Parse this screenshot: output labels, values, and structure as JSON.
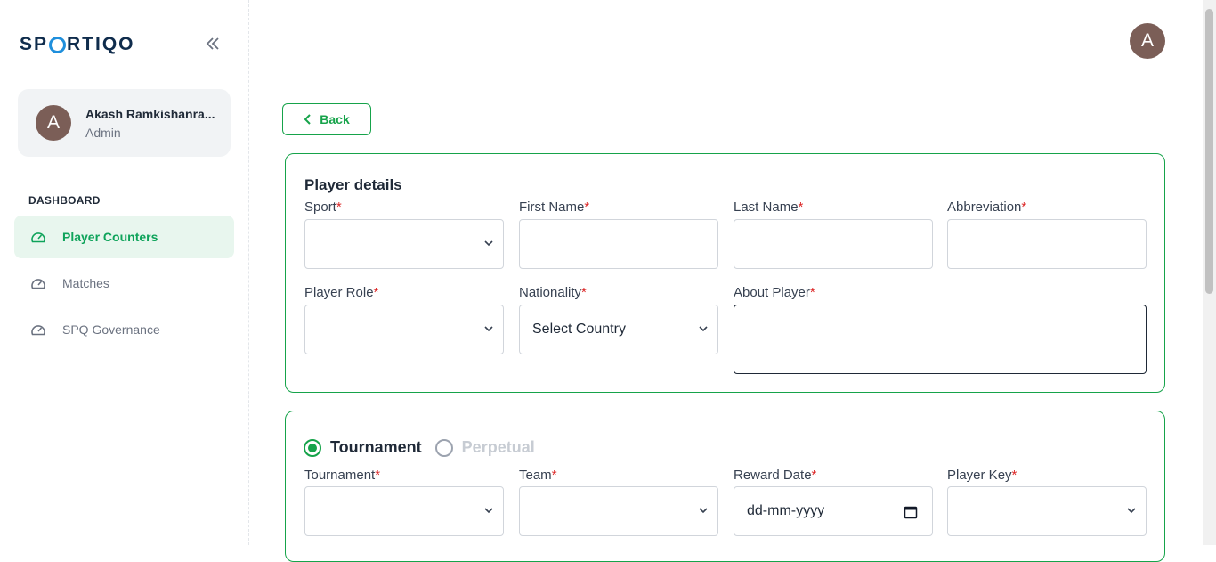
{
  "sidebar": {
    "logo": {
      "prefix": "SP",
      "suffix": "RTIQO"
    },
    "user": {
      "initial": "A",
      "name": "Akash Ramkishanra...",
      "role": "Admin"
    },
    "section_label": "DASHBOARD",
    "items": [
      {
        "label": "Player Counters",
        "active": true
      },
      {
        "label": "Matches",
        "active": false
      },
      {
        "label": "SPQ Governance",
        "active": false
      }
    ]
  },
  "header": {
    "avatar_initial": "A"
  },
  "back_label": "Back",
  "player_details": {
    "title": "Player details",
    "fields": {
      "sport": {
        "label": "Sport",
        "value": ""
      },
      "first_name": {
        "label": "First Name",
        "value": ""
      },
      "last_name": {
        "label": "Last Name",
        "value": ""
      },
      "abbreviation": {
        "label": "Abbreviation",
        "value": ""
      },
      "player_role": {
        "label": "Player Role",
        "value": ""
      },
      "nationality": {
        "label": "Nationality",
        "value": "Select Country"
      },
      "about_player": {
        "label": "About Player",
        "value": ""
      }
    },
    "required_mark": "*"
  },
  "reward": {
    "options": [
      {
        "label": "Tournament",
        "selected": true
      },
      {
        "label": "Perpetual",
        "selected": false
      }
    ],
    "fields": {
      "tournament": {
        "label": "Tournament",
        "value": ""
      },
      "team": {
        "label": "Team",
        "value": ""
      },
      "reward_date": {
        "label": "Reward Date",
        "placeholder": "dd-mm-yyyy"
      },
      "player_key": {
        "label": "Player Key",
        "value": ""
      }
    }
  },
  "colors": {
    "accent": "#16a34a",
    "avatar": "#7b5e57",
    "required": "#dc2626"
  }
}
